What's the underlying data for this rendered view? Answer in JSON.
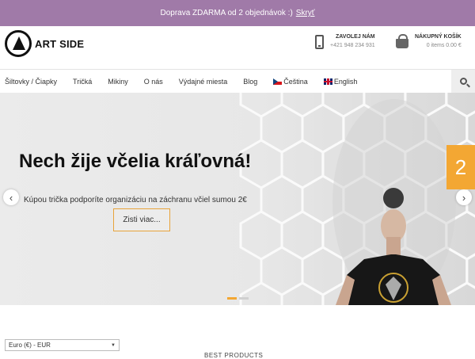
{
  "promo": {
    "text": "Doprava ZDARMA od 2 objednávok :)",
    "hide_label": "Skryť"
  },
  "header": {
    "logo_text": "ART SIDE",
    "phone": {
      "title": "ZAVOLEJ NÁM",
      "number": "+421 948 234 931"
    },
    "cart": {
      "title": "NÁKUPNÝ KOŠÍK",
      "summary": "0 items 0.00 €"
    }
  },
  "nav": {
    "items": [
      {
        "label": "Šiltovky / Čiapky"
      },
      {
        "label": "Tričká"
      },
      {
        "label": "Mikiny"
      },
      {
        "label": "O nás"
      },
      {
        "label": "Výdajné miesta"
      },
      {
        "label": "Blog"
      },
      {
        "label": "Čeština",
        "icon": "cz-flag-icon"
      },
      {
        "label": "English",
        "icon": "gb-flag-icon"
      }
    ],
    "search_icon": "search-icon"
  },
  "hero": {
    "title": "Nech žije včelia kráľovná!",
    "subtitle": "Kúpou trička podporíte organizáciu na záchranu včiel sumou 2€",
    "button_label": "Zisti viac...",
    "slide_number": "2",
    "prev_icon": "chevron-left-icon",
    "next_icon": "chevron-right-icon",
    "accent_color": "#f3a733",
    "dots": 2,
    "active_dot": 0
  },
  "footer": {
    "currency_selected": "Euro (€) - EUR",
    "best_products": "BEST PRODUCTS"
  },
  "colors": {
    "promo_bg": "#a07aa8",
    "accent": "#f3a733"
  }
}
